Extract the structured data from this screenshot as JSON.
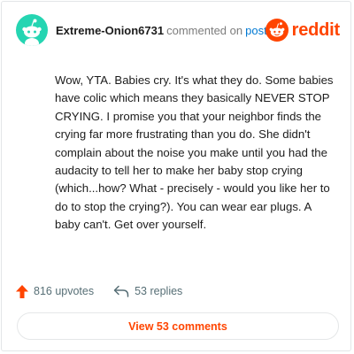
{
  "comment": {
    "username": "Extreme-Onion6731",
    "action_text": "commented on",
    "post_link": "post",
    "avatar_color": "#25d5b2",
    "body": "Wow, YTA. Babies cry. It's what they do. Some babies have colic which means they basically NEVER STOP CRYING. I promise you that your neighbor finds the crying far more frustrating than you do. She didn't complain about the noise you make until you had the audacity to tell her to make her baby stop crying (which...how? What - precisely - would you like her to do to stop the crying?). You can wear ear plugs. A baby can't. Get over yourself."
  },
  "brand": {
    "name": "reddit",
    "icon": "reddit-snoo-icon",
    "color": "#ff4500"
  },
  "stats": {
    "upvotes": "816 upvotes",
    "upvote_icon": "upvote-arrow-icon",
    "upvote_color": "#ff4500",
    "replies": "53 replies",
    "reply_icon": "reply-arrow-icon"
  },
  "actions": {
    "view_comments": "View 53 comments"
  }
}
